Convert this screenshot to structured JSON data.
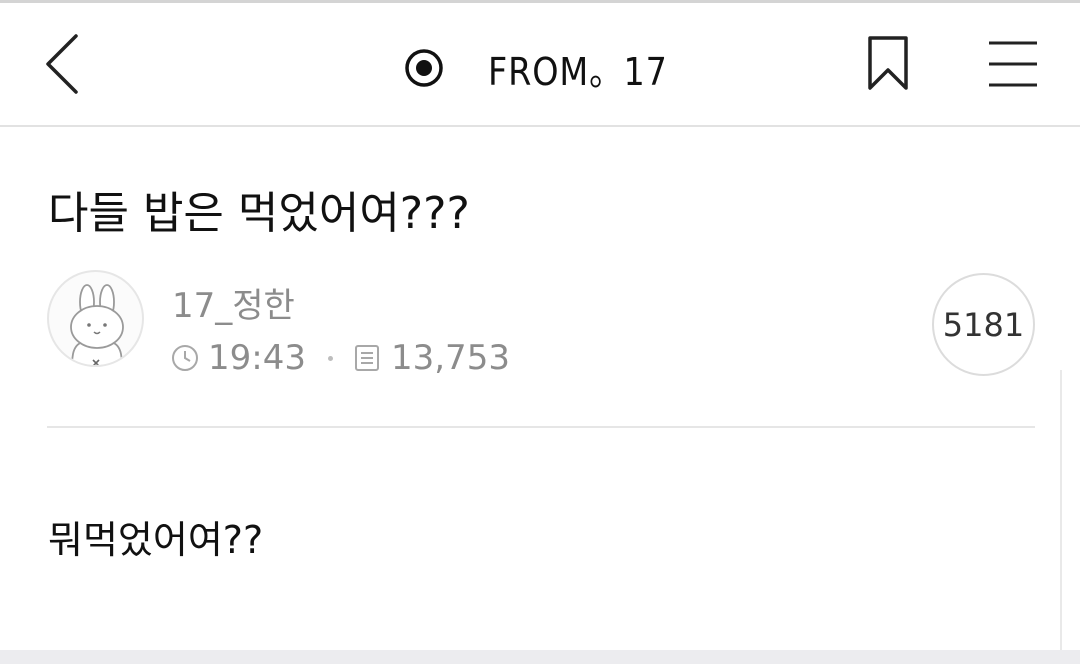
{
  "header": {
    "back_icon": "chevron-left-icon",
    "brand_icon": "radio-dot-icon",
    "brand_name": "FROM。17",
    "bookmark_icon": "bookmark-icon",
    "menu_icon": "hamburger-menu-icon"
  },
  "post": {
    "title": "다들 밥은 먹었어여???",
    "author": "17_정한",
    "time": "19:43",
    "views": "13,753",
    "comment_count": "5181",
    "body": "뭐먹었어여??"
  },
  "colors": {
    "text_primary": "#111111",
    "text_secondary": "#8c8c8c",
    "divider": "#e6e6e6"
  }
}
